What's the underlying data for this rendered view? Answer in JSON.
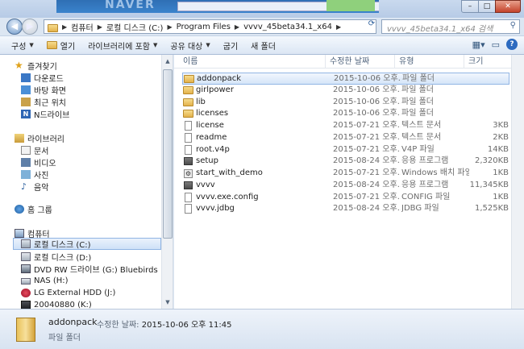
{
  "window": {
    "minimize_glyph": "–",
    "maximize_glyph": "□",
    "close_glyph": "✕",
    "background_app_text": "NAVER"
  },
  "address": {
    "crumbs": [
      "컴퓨터",
      "로컬 디스크 (C:)",
      "Program Files",
      "vvvv_45beta34.1_x64"
    ],
    "search_placeholder": "vvvv_45beta34.1_x64 검색"
  },
  "toolbar": {
    "organize": "구성",
    "open": "열기",
    "include_in_library": "라이브러리에 포함",
    "share_with": "공유 대상",
    "burn": "굽기",
    "new_folder": "새 폴더"
  },
  "nav": {
    "favorites": {
      "label": "즐겨찾기",
      "items": [
        "다운로드",
        "바탕 화면",
        "최근 위치",
        "N드라이브"
      ]
    },
    "libraries": {
      "label": "라이브러리",
      "items": [
        "문서",
        "비디오",
        "사진",
        "음악"
      ]
    },
    "homegroup": {
      "label": "홈 그룹"
    },
    "computer": {
      "label": "컴퓨터",
      "items": [
        "로컬 디스크 (C:)",
        "로컬 디스크 (D:)",
        "DVD RW 드라이브 (G:) Bluebirds",
        "NAS (H:)",
        "LG External HDD (J:)",
        "20040880 (K:)"
      ]
    }
  },
  "columns": {
    "name": "이름",
    "date": "수정한 날짜",
    "type": "유형",
    "size": "크기"
  },
  "files": [
    {
      "name": "addonpack",
      "date": "2015-10-06 오후...",
      "type": "파일 폴더",
      "size": "",
      "icon": "folder-icon",
      "selected": true
    },
    {
      "name": "girlpower",
      "date": "2015-10-06 오후...",
      "type": "파일 폴더",
      "size": "",
      "icon": "folder-icon"
    },
    {
      "name": "lib",
      "date": "2015-10-06 오후...",
      "type": "파일 폴더",
      "size": "",
      "icon": "folder-icon"
    },
    {
      "name": "licenses",
      "date": "2015-10-06 오후...",
      "type": "파일 폴더",
      "size": "",
      "icon": "folder-icon"
    },
    {
      "name": "license",
      "date": "2015-07-21 오후...",
      "type": "텍스트 문서",
      "size": "3KB",
      "icon": "text-file-icon"
    },
    {
      "name": "readme",
      "date": "2015-07-21 오후...",
      "type": "텍스트 문서",
      "size": "2KB",
      "icon": "text-file-icon"
    },
    {
      "name": "root.v4p",
      "date": "2015-07-21 오후...",
      "type": "V4P 파일",
      "size": "14KB",
      "icon": "file-icon"
    },
    {
      "name": "setup",
      "date": "2015-08-24 오후...",
      "type": "응용 프로그램",
      "size": "2,320KB",
      "icon": "app-icon"
    },
    {
      "name": "start_with_demo",
      "date": "2015-07-21 오후...",
      "type": "Windows 배치 파일",
      "size": "1KB",
      "icon": "batch-file-icon"
    },
    {
      "name": "vvvv",
      "date": "2015-08-24 오후...",
      "type": "응용 프로그램",
      "size": "11,345KB",
      "icon": "app-icon"
    },
    {
      "name": "vvvv.exe.config",
      "date": "2015-07-21 오후...",
      "type": "CONFIG 파일",
      "size": "1KB",
      "icon": "file-icon"
    },
    {
      "name": "vvvv.jdbg",
      "date": "2015-08-24 오후...",
      "type": "JDBG 파일",
      "size": "1,525KB",
      "icon": "file-icon"
    }
  ],
  "details": {
    "name": "addonpack",
    "meta_label": "수정한 날짜:",
    "meta_value": "2015-10-06 오후 11:45",
    "type": "파일 폴더"
  }
}
